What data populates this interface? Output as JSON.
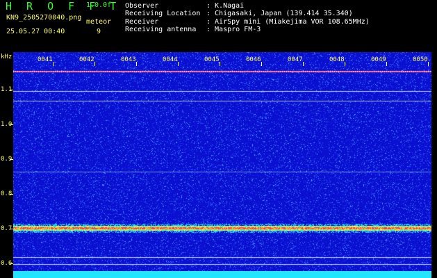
{
  "header": {
    "app_title": "H R O F F T",
    "version": "1.0.0f",
    "filename": "KN9_2505270040.png",
    "meteor_label": "meteor",
    "datetime": "25.05.27 00:40",
    "meteor_count": "9",
    "info": [
      {
        "label": "Observer",
        "value": ": K.Nagai"
      },
      {
        "label": "Receiving Location",
        "value": ": Chigasaki, Japan (139.414 35.340)"
      },
      {
        "label": "Receiver",
        "value": ": AirSpy mini (Miakejima VOR 108.65MHz)"
      },
      {
        "label": "Receiving antenna",
        "value": ": Maspro FM-3"
      }
    ]
  },
  "spectrogram": {
    "y_unit": "kHz",
    "y_ticks": [
      "1.1",
      "1.0",
      "0.9",
      "0.8",
      "0.7",
      "0.6"
    ],
    "x_ticks": [
      "0041",
      "0042",
      "0043",
      "0044",
      "0045",
      "0046",
      "0047",
      "0048",
      "0049",
      "0050"
    ],
    "colors": {
      "background": "#0a0fd0",
      "noise": "#3a6cff",
      "signal": "#ff3355",
      "strip": "#22e6ff"
    }
  }
}
